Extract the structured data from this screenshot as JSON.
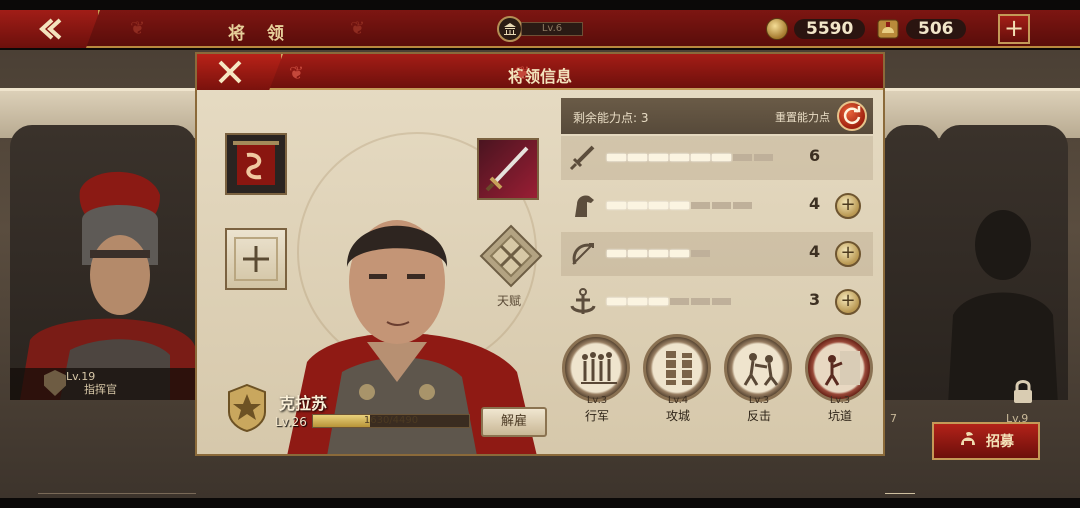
{
  "topbar": {
    "title": "将 领",
    "city_level": "Lv.6",
    "gold": "5590",
    "honor": "506"
  },
  "modal": {
    "title": "将领信息",
    "talent_label": "天赋",
    "hero": {
      "name": "克拉苏",
      "level": "Lv.26",
      "xp_text": "1630/4490",
      "xp_fraction": 0.363,
      "dismiss_label": "解雇"
    },
    "points": {
      "remaining_label": "剩余能力点: 3",
      "reset_label": "重置能力点"
    },
    "stats": [
      {
        "icon": "sword-icon",
        "value": "6",
        "pips_on": 6,
        "pips_total": 8,
        "has_plus": false
      },
      {
        "icon": "horse-icon",
        "value": "4",
        "pips_on": 4,
        "pips_total": 7,
        "has_plus": true
      },
      {
        "icon": "bow-icon",
        "value": "4",
        "pips_on": 4,
        "pips_total": 5,
        "has_plus": true
      },
      {
        "icon": "anchor-icon",
        "value": "3",
        "pips_on": 3,
        "pips_total": 6,
        "has_plus": true
      }
    ],
    "skills": [
      {
        "level": "Lv.3",
        "name": "行军"
      },
      {
        "level": "Lv.4",
        "name": "攻城"
      },
      {
        "level": "Lv.3",
        "name": "反击"
      },
      {
        "level": "Lv.3",
        "name": "坑道"
      }
    ]
  },
  "background": {
    "left_card_level": "Lv.19",
    "left_card_role": "指挥官",
    "mid_card_level": "7",
    "locked_card_level": "Lv.9",
    "recruit_label": "招募"
  },
  "colors": {
    "accent_red": "#8a1712",
    "gold_trim": "#c49a58",
    "parchment": "#e2d6bd"
  }
}
